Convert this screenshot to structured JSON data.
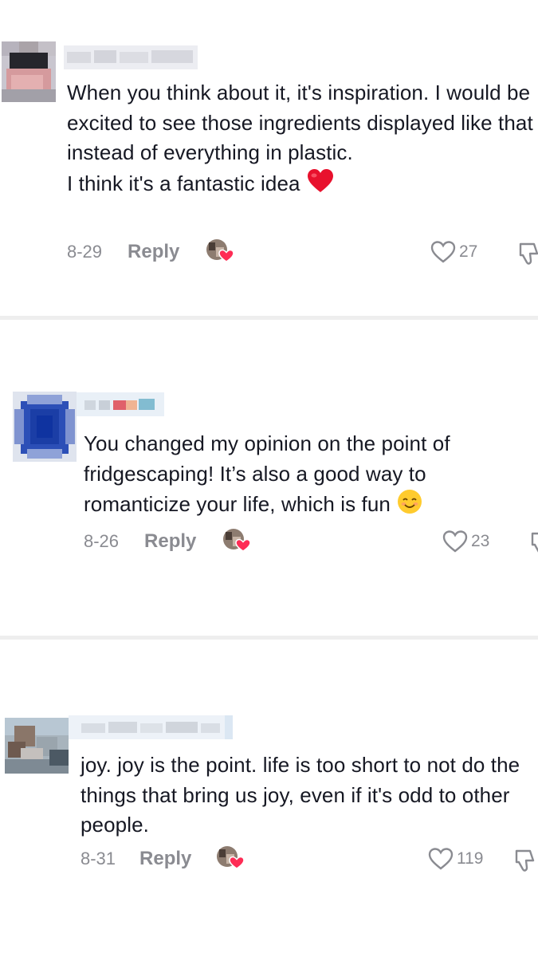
{
  "comments": [
    {
      "text": "When you think about it, it's inspiration. I would be excited to see those ingredients displayed like that instead of everything in plastic.\nI think it's a fantastic idea",
      "emoji": "heart-emoji",
      "date": "8-29",
      "reply_label": "Reply",
      "likes": "27"
    },
    {
      "text": "You changed my opinion on the point of fridgescaping! It’s also a good way to romanticize your life, which is fun",
      "emoji": "smiling-face-emoji",
      "date": "8-26",
      "reply_label": "Reply",
      "likes": "23"
    },
    {
      "text": "joy. joy is the point. life is too short to not do the things that bring us joy, even if it's odd to other people.",
      "emoji": "",
      "date": "8-31",
      "reply_label": "Reply",
      "likes": "119"
    }
  ],
  "colors": {
    "text": "#161823",
    "secondary": "#8a8b91",
    "divider": "#eeeeee",
    "like_heart": "#fe2c55"
  },
  "icons": [
    "blurred-avatar",
    "blurred-username",
    "creator-liked-icon",
    "heart-outline-icon",
    "dislike-icon",
    "heart-emoji",
    "smiling-face-emoji"
  ]
}
